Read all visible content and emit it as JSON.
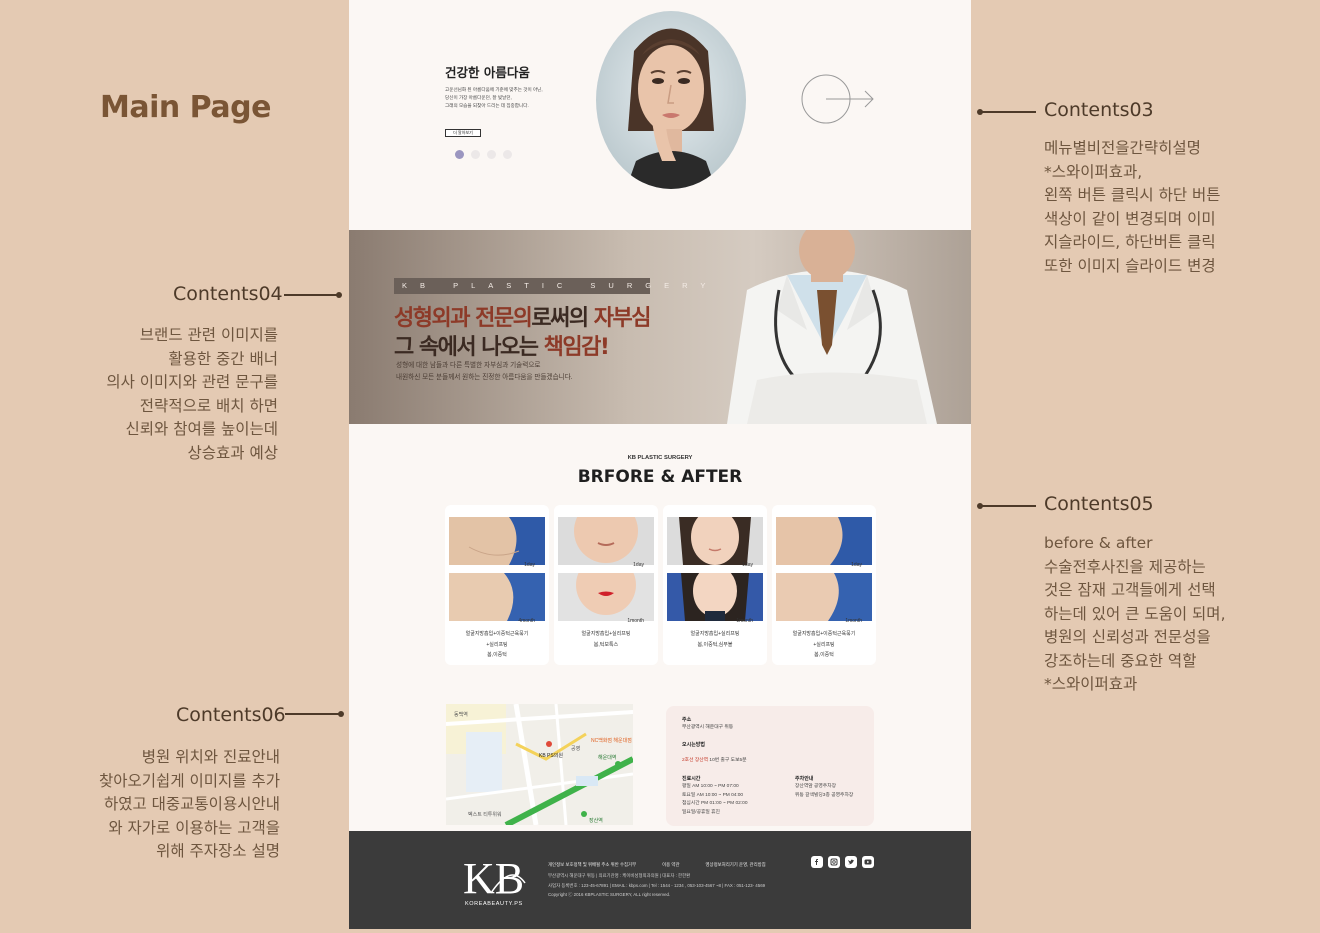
{
  "main_title": "Main Page",
  "annotations": {
    "contents03": {
      "title": "Contents03",
      "text": "메뉴별비전을간략히설명\n*스와이퍼효과,\n왼쪽 버튼 클릭시 하단 버튼\n색상이 같이 변경되며 이미\n지슬라이드, 하단버튼 클릭\n또한 이미지 슬라이드 변경"
    },
    "contents04": {
      "title": "Contents04",
      "text": "브랜드 관련 이미지를\n활용한 중간 배너\n의사 이미지와 관련 문구를\n전략적으로 배치 하면\n신뢰와 참여를 높이는데\n상승효과 예상"
    },
    "contents05": {
      "title": "Contents05",
      "text": "before & after\n수술전후사진을 제공하는\n것은 잠재 고객들에게 선택\n하는데 있어 큰 도움이 되며,\n병원의 신뢰성과 전문성을\n강조하는데 중요한 역할\n*스와이퍼효과"
    },
    "contents06": {
      "title": "Contents06",
      "text": "병원 위치와 진료안내\n찾아오기쉽게 이미지를 추가\n하였고 대중교통이용시안내\n와 자가로 이용하는 고객을\n위해 주자장소 설명"
    }
  },
  "hero": {
    "heading": "건강한 아름다움",
    "body": "고운선님화 된 아름다움에 기준에 맞추는 것이 아닌,\n당신이 가장 아름다운던, 잘 빛날던,\n그래의 모습을 되찾아 드리는 데 집중합니다.",
    "button": "더 알아보기",
    "slide_count": 4,
    "active_slide": 1
  },
  "banner": {
    "tag": "KB PLASTIC SURGERY",
    "line1_a": "성형외과 전문의",
    "line1_b": "로써의 ",
    "line1_c": "자부심",
    "line2_a": "그 속에서 나오는 ",
    "line2_b": "책임감!",
    "sub": "성형에 대한 남들과 다른 특별한 자부심과 기술력으로\n내원하신 모든 분들께서 원하는 진정한 아름다움을 만들겠습니다."
  },
  "before_after": {
    "kicker": "KB PLASTIC SURGERY",
    "title": "BRFORE & AFTER",
    "cards": [
      {
        "before_label": "1day",
        "after_label": "4month",
        "desc": "얼굴지방흡입+이중턱근육묶기\n+실리프팅\n봄,이중턱"
      },
      {
        "before_label": "1day",
        "after_label": "1month",
        "desc": "얼굴지방흡입+실리프팅\n봄,턱보톡스"
      },
      {
        "before_label": "1day",
        "after_label": "1month",
        "desc": "얼굴지방흡입+실리프팅\n봄,이중턱,심부볼"
      },
      {
        "before_label": "1day",
        "after_label": "1month",
        "desc": "얼굴지방흡입+이중턱근육묶기\n+실리프팅\n봄,이중턱"
      }
    ]
  },
  "location": {
    "map_labels": [
      "KB PS의원",
      "해운대역",
      "장산역",
      "NC백화점 해운대점",
      "공영",
      "동백역",
      "벡스트 티투위워"
    ],
    "address_title": "주소",
    "address": "부산광역시 해운대구 위등",
    "route_title": "오시는방법",
    "route_highlight": "2호선 장산역",
    "route_rest": " 10번 출구 도보5분",
    "hours_title": "진료시간",
    "hours": "평일       AM 10:00 ~ PM 07:00\n토요일     AM 10:00 ~ PM 04:00\n점심시간   PM 01:00 ~ PM 02:00\n일요일/공휴일 휴진",
    "parking_title": "주차안내",
    "parking": "장산역앞 공영주차장\n위동 갈색빌딩3층 공영주차장"
  },
  "footer": {
    "logo_text": "KB",
    "brand": "KOREABEAUTY.PS",
    "links": [
      "개인정보 보호정책 및 위배될 주소 위반 수집거부",
      "이용 약관",
      "영상정보처리기기 운영, 관리방침"
    ],
    "row1": "부산광역시 해운대구 위동   |   의료기관명 : 케이비성형외과의원   |   대표자 : 한한환",
    "row2": "사업자 등록번호 : 123-45-67891   |   EMAIL : kbps.com   |   Tel : 1544 - 1234 , 053-103-4567 ~8   |   FAX : 051-123- 4569",
    "row3": "Copyright  ⓒ  2016 KBPLASTIC SURGERY, ALL right reserved.",
    "social_icons": [
      "facebook-icon",
      "instagram-icon",
      "twitter-icon",
      "youtube-icon"
    ]
  }
}
